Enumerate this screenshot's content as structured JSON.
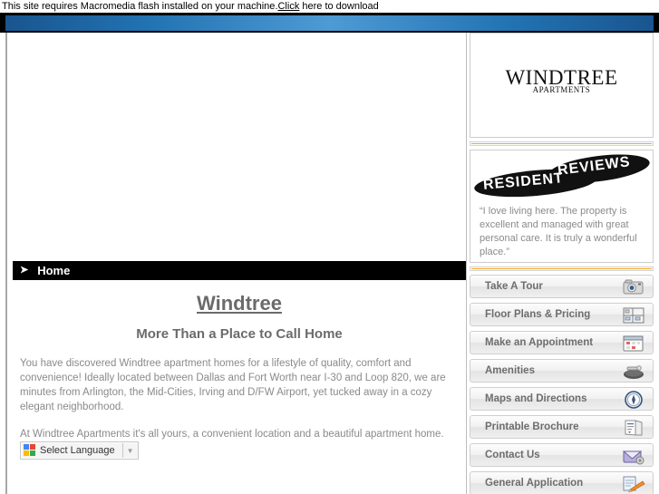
{
  "browser_notice": {
    "text_before": "This site requires Macromedia flash installed on your machine.",
    "link_text": "Click",
    "text_after": " here to download"
  },
  "branding": {
    "logo_main": "WINDTREE",
    "logo_sub": "APARTMENTS",
    "accent_green": "#b5c92a",
    "accent_orange": "#f5a623",
    "header_blue": "#2273b2"
  },
  "reviews": {
    "banner_word_1": "RESIDENT",
    "banner_word_2": "REVIEWS",
    "quote": "“I love living here. The property is excellent and managed with great personal care. It is truly a wonderful place.”"
  },
  "breadcrumb": {
    "arrow": "➤",
    "label": "Home"
  },
  "main": {
    "title": "Windtree",
    "subtitle": "More Than a Place to Call Home",
    "paragraph_1": "You have discovered Windtree apartment homes for a lifestyle of quality, comfort and convenience! Ideally located between Dallas and Fort Worth near I-30 and Loop 820, we are minutes from Arlington, the Mid-Cities, Irving and D/FW Airport, yet tucked away in a cozy elegant neighborhood.",
    "paragraph_2": "At Windtree Apartments it's all yours, a convenient location and a beautiful apartment home."
  },
  "translate": {
    "label": "Select Language",
    "arrow": "▼",
    "icon": "google-translate-icon"
  },
  "nav": {
    "items": [
      {
        "label": "Take A Tour",
        "icon": "camera-icon"
      },
      {
        "label": "Floor Plans & Pricing",
        "icon": "floorplan-icon"
      },
      {
        "label": "Make an Appointment",
        "icon": "calendar-icon"
      },
      {
        "label": "Amenities",
        "icon": "pool-icon"
      },
      {
        "label": "Maps and Directions",
        "icon": "compass-icon"
      },
      {
        "label": "Printable Brochure",
        "icon": "brochure-icon"
      },
      {
        "label": "Contact Us",
        "icon": "envelope-icon"
      },
      {
        "label": "General Application",
        "icon": "pencil-form-icon"
      }
    ]
  }
}
